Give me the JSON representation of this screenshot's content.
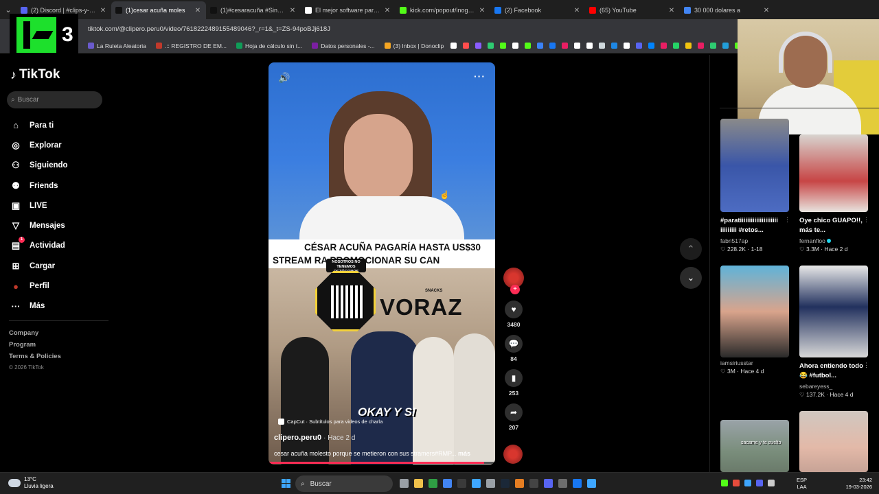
{
  "browser": {
    "tabs": [
      {
        "label": "(2) Discord | #clips-y-dest",
        "color": "#5865f2",
        "active": false
      },
      {
        "label": "(1)cesar acuña moles",
        "color": "#111111",
        "active": true
      },
      {
        "label": "(1)#cesaracuña #SinGuio",
        "color": "#111111",
        "active": false
      },
      {
        "label": "El mejor software para po",
        "color": "#ffffff",
        "active": false
      },
      {
        "label": "kick.com/popout/inogard",
        "color": "#53fc18",
        "active": false
      },
      {
        "label": "(2) Facebook",
        "color": "#1877f2",
        "active": false
      },
      {
        "label": "(65) YouTube",
        "color": "#ff0000",
        "active": false
      },
      {
        "label": "30 000 dolares a",
        "color": "#4285f4",
        "active": false
      }
    ],
    "url": "tiktok.com/@clipero.peru0/video/7618222489155489046?_r=1&_t=ZS-94poBJj618J",
    "bookmarks": [
      {
        "label": "La Ruleta Aleatoria",
        "color": "#6a5acd"
      },
      {
        "label": ".:: REGISTRO DE EM...",
        "color": "#c0392b"
      },
      {
        "label": "Hoja de cálculo sin t...",
        "color": "#0f9d58"
      },
      {
        "label": "Datos personales -...",
        "color": "#7b1fa2"
      },
      {
        "label": "(3) Inbox | Donoclip",
        "color": "#f5a623"
      }
    ],
    "bookmark_icon_colors": [
      "#ffffff",
      "#ff4d4d",
      "#8a5cff",
      "#2ecc71",
      "#53fc18",
      "#ffffff",
      "#53fc18",
      "#3b82f6",
      "#1877f2",
      "#e91e63",
      "#ffffff",
      "#ffffff",
      "#cfd8dc",
      "#1e88e5",
      "#ffffff",
      "#5865f2",
      "#0084ff",
      "#e91e63",
      "#25d366",
      "#f1c40f",
      "#e91e63",
      "#2ecc71",
      "#229ed9",
      "#53fc18"
    ]
  },
  "overlay_logo": {
    "number": "3"
  },
  "sidebar": {
    "brand": "TikTok",
    "search_placeholder": "Buscar",
    "nav": [
      {
        "label": "Para ti",
        "icon": "home-icon",
        "glyph": "⌂"
      },
      {
        "label": "Explorar",
        "icon": "compass-icon",
        "glyph": "◎"
      },
      {
        "label": "Siguiendo",
        "icon": "following-icon",
        "glyph": "⚇"
      },
      {
        "label": "Friends",
        "icon": "friends-icon",
        "glyph": "⚉"
      },
      {
        "label": "LIVE",
        "icon": "live-icon",
        "glyph": "▣"
      },
      {
        "label": "Mensajes",
        "icon": "messages-icon",
        "glyph": "▽"
      },
      {
        "label": "Actividad",
        "icon": "activity-icon",
        "glyph": "▤",
        "badge": "1"
      },
      {
        "label": "Cargar",
        "icon": "upload-icon",
        "glyph": "⊞"
      },
      {
        "label": "Perfil",
        "icon": "profile-avatar-icon",
        "glyph": "●"
      },
      {
        "label": "Más",
        "icon": "more-icon",
        "glyph": "···"
      }
    ],
    "footer_links": [
      "Company",
      "Program",
      "Terms & Policies"
    ],
    "copyright": "© 2026 TikTok"
  },
  "video": {
    "headline_line1": "CÉSAR ACUÑA PAGARÍA HASTA US$30",
    "headline_line2": "STREAM           RA PROMOCIONAR SU CAN",
    "octagon_text": "NOSOTROS NO TENEMOS OCTÓGONOS",
    "brand": "VORAZ",
    "brand_small": "SNACKS",
    "overlay_text": "OKAY Y SI",
    "capcut": "CapCut · Subtítulos para videos de charla",
    "author": "clipero.peru0",
    "time_ago": "· Hace 2 d",
    "caption": "cesar acuña molesto porque se metieron con sus stramers#RMP...",
    "more": "más",
    "progress": 0.95
  },
  "actions": {
    "likes": "3480",
    "comments": "84",
    "saves": "253",
    "shares": "207"
  },
  "recommended": [
    {
      "title": "#paratiiiiiiiiiiiiiiiiiiiii iiiiiiiii #retos...",
      "user": "fabri517ap",
      "stats": "♡ 228.2K · 1-18",
      "verified": false,
      "thumb": "linear-gradient(180deg,#8a8a8a 0%,#3a56a8 50%,#4d6cc2 100%)"
    },
    {
      "title": "Oye chico GUAPO!!, más te...",
      "user": "fernanfloo",
      "stats": "♡ 3.3M · Hace 2 d",
      "verified": true,
      "thumb": "linear-gradient(180deg,#d8d4cf 0%,#c74545 60%,#e8e4df 100%)"
    },
    {
      "title": "",
      "user": "iamsiriusstar",
      "stats": "♡ 3M · Hace 4 d",
      "verified": false,
      "thumb": "linear-gradient(180deg,#5fb3d9 0%,#d9a48c 50%,#2a2a2a 100%)"
    },
    {
      "title": "Ahora entiendo todo 😂 #futbol...",
      "user": "sebareyess_",
      "stats": "♡ 137.2K · Hace 4 d",
      "verified": false,
      "thumb": "linear-gradient(180deg,#e8e8e8 0%,#22315e 45%,#d8d8d8 100%)"
    },
    {
      "title": "",
      "user": "",
      "stats": "",
      "verified": false,
      "thumb": "linear-gradient(180deg,#9aa3a8 0%,#7a8e7c 60%,#6a7a6a 100%)",
      "overlay": "sacame y te suelto"
    },
    {
      "title": "",
      "user": "",
      "stats": "",
      "verified": false,
      "thumb": "linear-gradient(180deg,#d0c7c0 0%,#e3b9a8 60%,#c7a396 100%)"
    }
  ],
  "taskbar": {
    "temp": "13°C",
    "weather": "Lluvia ligera",
    "search": "Buscar",
    "lang1": "ESP",
    "lang2": "LAA",
    "time": "23:42",
    "date": "19-03-2026",
    "app_colors": [
      "#9aa0a6",
      "#f0c14b",
      "#2f9e44",
      "#4285f4",
      "#3a3a3a",
      "#3ea6ff",
      "#9aa0a6",
      "#1b2838",
      "#e67e22",
      "#444444",
      "#5865f2",
      "#6d6d6d",
      "#1877f2",
      "#3ea6ff"
    ],
    "tray_colors": [
      "#53fc18",
      "#e74c3c",
      "#3ea6ff",
      "#5865f2",
      "#cccccc"
    ]
  }
}
